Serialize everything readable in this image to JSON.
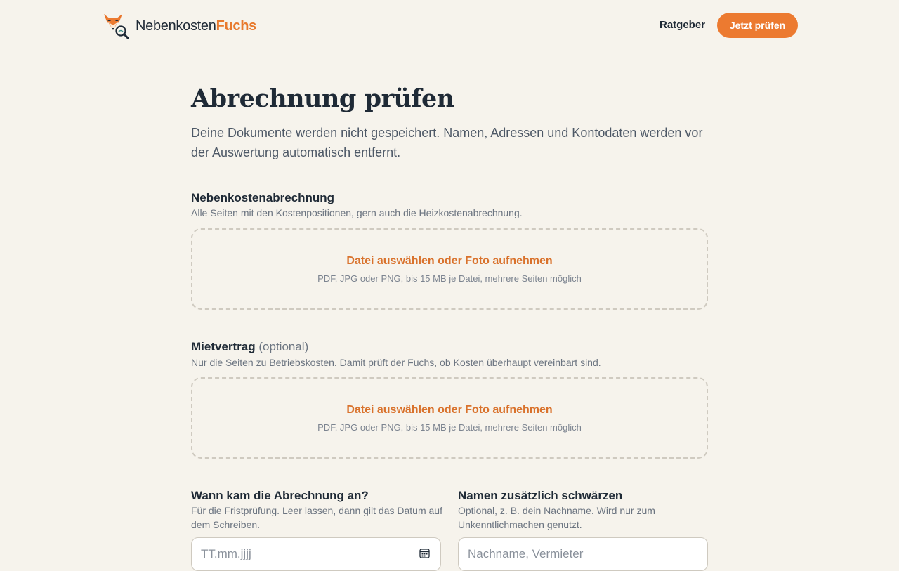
{
  "header": {
    "brand_part1": "Nebenkosten",
    "brand_part2": "Fuchs",
    "nav_link": "Ratgeber",
    "cta_label": "Jetzt prüfen"
  },
  "main": {
    "title": "Abrechnung prüfen",
    "lead": "Deine Dokumente werden nicht gespeichert. Namen, Adressen und Kontodaten werden vor der Auswertung automatisch entfernt."
  },
  "upload_statement": {
    "label": "Nebenkostenabrechnung",
    "hint": "Alle Seiten mit den Kostenpositionen, gern auch die Heizkostenabrechnung.",
    "dropzone_title": "Datei auswählen oder Foto aufnehmen",
    "dropzone_sub": "PDF, JPG oder PNG, bis 15 MB je Datei, mehrere Seiten möglich"
  },
  "upload_contract": {
    "label": "Mietvertrag",
    "optional": "(optional)",
    "hint": "Nur die Seiten zu Betriebskosten. Damit prüft der Fuchs, ob Kosten überhaupt vereinbart sind.",
    "dropzone_title": "Datei auswählen oder Foto aufnehmen",
    "dropzone_sub": "PDF, JPG oder PNG, bis 15 MB je Datei, mehrere Seiten möglich"
  },
  "date_field": {
    "label": "Wann kam die Abrechnung an?",
    "hint": "Für die Fristprüfung. Leer lassen, dann gilt das Datum auf dem Schreiben.",
    "placeholder": "TT.mm.jjjj",
    "icon": "calendar-icon"
  },
  "redact_field": {
    "label": "Namen zusätzlich schwärzen",
    "hint": "Optional, z. B. dein Nachname. Wird nur zum Unkenntlichmachen genutzt.",
    "placeholder": "Nachname, Vermieter"
  },
  "colors": {
    "accent": "#ec7a30",
    "background": "#f6f3ec",
    "text": "#1f2a36"
  }
}
